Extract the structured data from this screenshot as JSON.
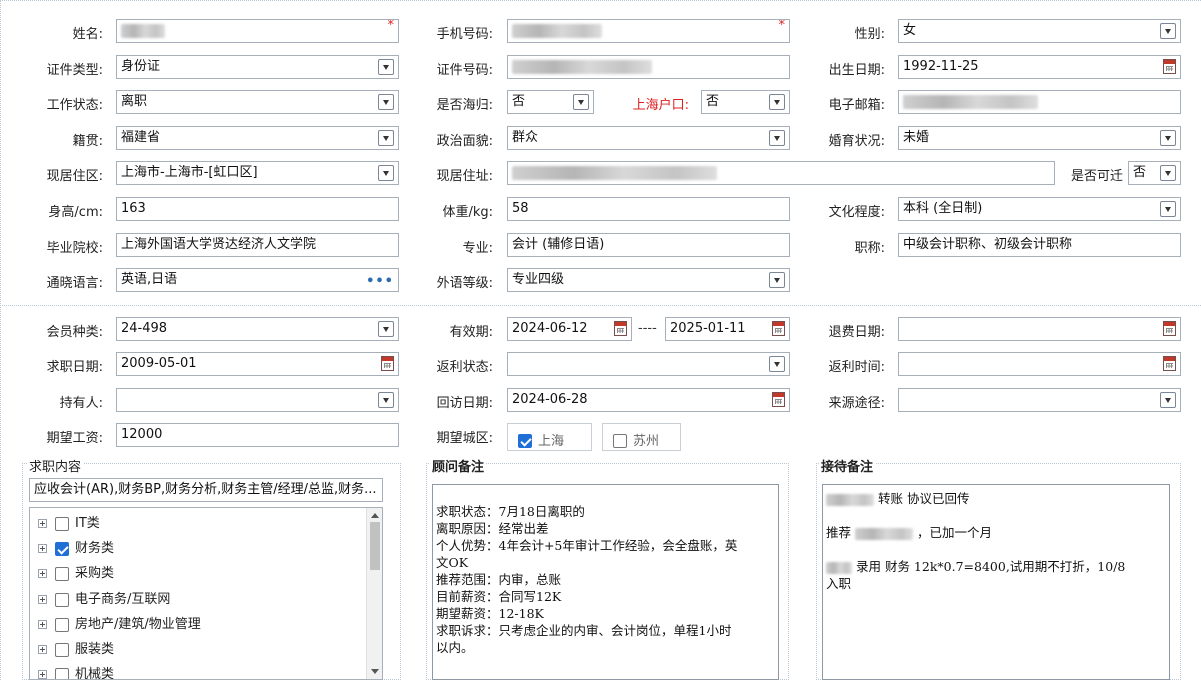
{
  "personal": {
    "name_label": "姓名:",
    "phone_label": "手机号码:",
    "gender_label": "性别:",
    "gender_value": "女",
    "idtype_label": "证件类型:",
    "idtype_value": "身份证",
    "idno_label": "证件号码:",
    "birth_label": "出生日期:",
    "birth_value": "1992-11-25",
    "workstatus_label": "工作状态:",
    "workstatus_value": "离职",
    "overseas_label": "是否海归:",
    "overseas_value": "否",
    "hukou_label": "上海户口:",
    "hukou_value": "否",
    "email_label": "电子邮箱:",
    "native_label": "籍贯:",
    "native_value": "福建省",
    "political_label": "政治面貌:",
    "political_value": "群众",
    "marital_label": "婚育状况:",
    "marital_value": "未婚",
    "region_label": "现居住区:",
    "region_value": "上海市-上海市-[虹口区]",
    "address_label": "现居住址:",
    "relocate_label": "是否可迁",
    "relocate_value": "否",
    "height_label": "身高/cm:",
    "height_value": "163",
    "weight_label": "体重/kg:",
    "weight_value": "58",
    "education_label": "文化程度:",
    "education_value": "本科 (全日制)",
    "school_label": "毕业院校:",
    "school_value": "上海外国语大学贤达经济人文学院",
    "major_label": "专业:",
    "major_value": "会计 (辅修日语)",
    "title_label": "职称:",
    "title_value": "中级会计职称、初级会计职称",
    "language_label": "通晓语言:",
    "language_value": "英语,日语",
    "foreign_label": "外语等级:",
    "foreign_value": "专业四级"
  },
  "membership": {
    "type_label": "会员种类:",
    "type_value": "24-498",
    "validity_label": "有效期:",
    "valid_from": "2024-06-12",
    "valid_sep": "----",
    "valid_to": "2025-01-11",
    "refund_label": "退费日期:",
    "jobdate_label": "求职日期:",
    "jobdate_value": "2009-05-01",
    "rebate_status_label": "返利状态:",
    "rebate_time_label": "返利时间:",
    "holder_label": "持有人:",
    "revisit_label": "回访日期:",
    "revisit_value": "2024-06-28",
    "source_label": "来源途径:",
    "salary_label": "期望工资:",
    "salary_value": "12000",
    "city_label": "期望城区:",
    "city_options": [
      {
        "label": "上海",
        "checked": true
      },
      {
        "label": "苏州",
        "checked": false
      }
    ]
  },
  "job_content": {
    "title": "求职内容",
    "summary": "应收会计(AR),财务BP,财务分析,财务主管/经理/总监,财务...",
    "tree": [
      {
        "label": "IT类",
        "checked": false
      },
      {
        "label": "财务类",
        "checked": true
      },
      {
        "label": "采购类",
        "checked": false
      },
      {
        "label": "电子商务/互联网",
        "checked": false
      },
      {
        "label": "房地产/建筑/物业管理",
        "checked": false
      },
      {
        "label": "服装类",
        "checked": false
      },
      {
        "label": "机械类",
        "checked": false
      }
    ]
  },
  "advisor_notes": {
    "title": "顾问备注",
    "lines": [
      "求职状态：7月18日离职的",
      "离职原因：经常出差",
      "个人优势：4年会计+5年审计工作经验，会全盘账，英",
      "文OK",
      "推荐范围：内审，总账",
      "目前薪资：合同写12K",
      "期望薪资：12-18K",
      "求职诉求：只考虑企业的内审、会计岗位，单程1小时",
      "以内。"
    ]
  },
  "reception_notes": {
    "title": "接待备注",
    "line1": "转账    协议已回传",
    "line2_pre": "推荐",
    "line2_post": "，已加一个月",
    "line3_a": "录用  财务  12k*0.7=8400,试用期不打折，10/8",
    "line3_b": "入职"
  }
}
